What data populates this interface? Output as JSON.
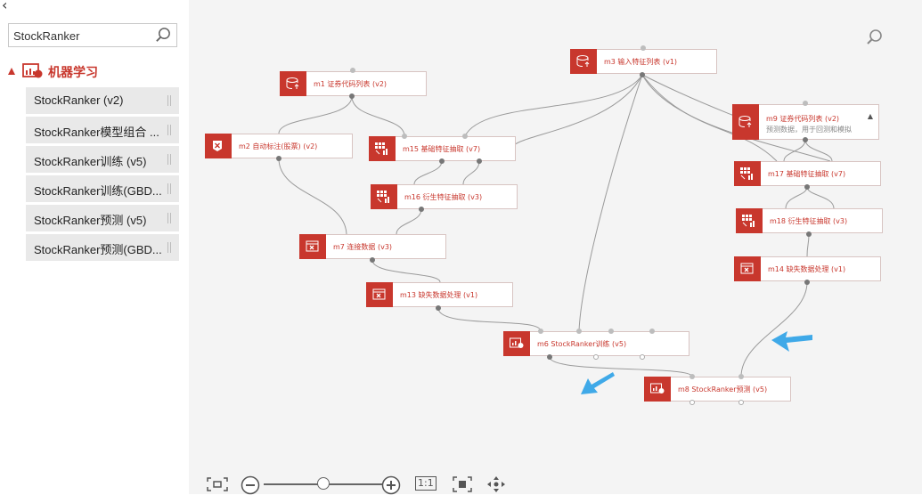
{
  "sidebar": {
    "back_glyph": "‹",
    "search": {
      "value": "StockRanker",
      "icon": "search-icon"
    },
    "category": {
      "label": "机器学习",
      "icon": "machine-learning-icon"
    },
    "items": [
      {
        "label": "StockRanker (v2)"
      },
      {
        "label": "StockRanker模型组合 ..."
      },
      {
        "label": "StockRanker训练 (v5)"
      },
      {
        "label": "StockRanker训练(GBD..."
      },
      {
        "label": "StockRanker预测 (v5)"
      },
      {
        "label": "StockRanker预测(GBD..."
      }
    ]
  },
  "canvas": {
    "nodes": {
      "m1": {
        "label": "m1 证券代码列表 (v2)"
      },
      "m2": {
        "label": "m2 自动标注(股票) (v2)"
      },
      "m3": {
        "label": "m3 输入特征列表 (v1)"
      },
      "m9": {
        "label": "m9 证券代码列表 (v2)",
        "desc": "预测数据，用于回测和模拟"
      },
      "m15": {
        "label": "m15 基础特征抽取 (v7)"
      },
      "m16": {
        "label": "m16 衍生特征抽取 (v3)"
      },
      "m17": {
        "label": "m17 基础特征抽取 (v7)"
      },
      "m18": {
        "label": "m18 衍生特征抽取 (v3)"
      },
      "m7": {
        "label": "m7 连接数据 (v3)"
      },
      "m13": {
        "label": "m13 缺失数据处理 (v1)"
      },
      "m14": {
        "label": "m14 缺失数据处理 (v1)"
      },
      "m6": {
        "label": "m6 StockRanker训练 (v5)"
      },
      "m8": {
        "label": "m8 StockRanker预测 (v5)"
      }
    },
    "highlight_color": "#3fa9e8",
    "accent_color": "#c8372d"
  },
  "zoom": {
    "fit_icon": "fit-screen-icon",
    "zoom_out_icon": "zoom-out-icon",
    "zoom_in_icon": "zoom-in-icon",
    "actual_size_label": "1:1",
    "center_icon": "center-focus-icon",
    "pan_icon": "pan-move-icon",
    "level": 0.48
  }
}
